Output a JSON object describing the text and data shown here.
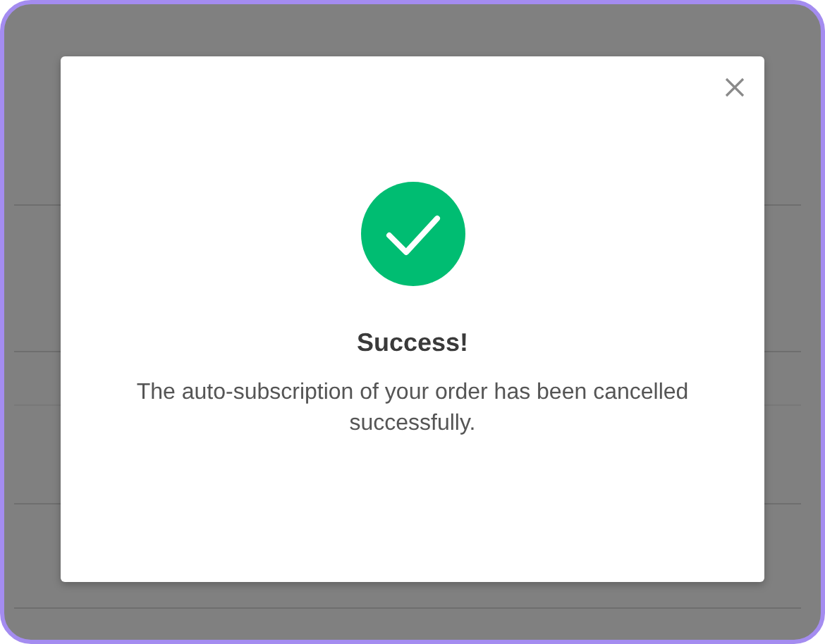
{
  "dialog": {
    "title": "Success!",
    "message": "The auto-subscription of your order has been cancelled successfully."
  }
}
